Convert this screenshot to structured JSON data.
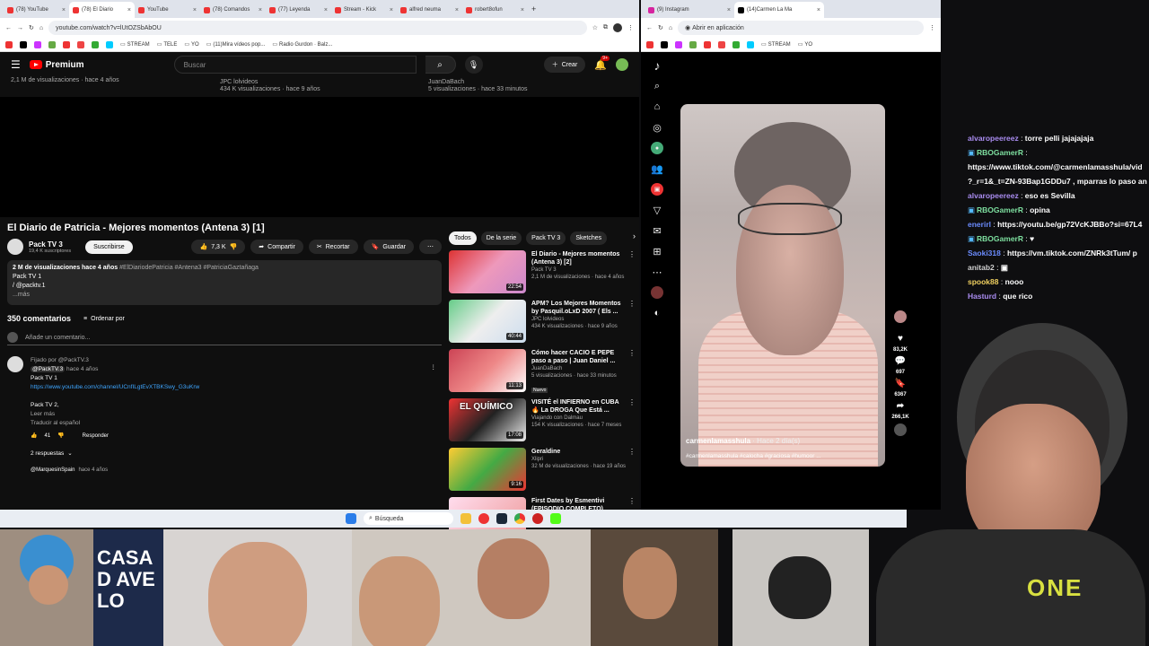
{
  "browser1": {
    "tabs": [
      "(78) YouTube",
      "(78) El Diario",
      "YouTube",
      "(78) Comandos",
      "(77) Leyenda",
      "Stream - Kick",
      "alfred neuma",
      "robert8ofun"
    ],
    "url": "youtube.com/watch?v=lUtOZSbAbOU",
    "bookmarks": [
      "STREAM",
      "TELE",
      "YO",
      "(11)Mira vídeos pop...",
      "Radio Gurdon · Balz..."
    ],
    "yt": {
      "logo": "Premium",
      "search_placeholder": "Buscar",
      "create": "Crear",
      "notif_count": "9+",
      "top_row": [
        {
          "line1": "",
          "line2": "2,1 M de visualizaciones · hace 4 años"
        },
        {
          "line1": "JPC lolvideos",
          "line2": "434 K visualizaciones · hace 9 años"
        },
        {
          "line1": "JuanDaBach",
          "line2": "5 visualizaciones · hace 33 minutos"
        }
      ],
      "video_title": "El Diario de Patricia - Mejores momentos (Antena 3) [1]",
      "channel": "Pack TV 3",
      "subs": "19,4 K suscriptores",
      "subscribe": "Suscribirse",
      "likes": "7,3 K",
      "share": "Compartir",
      "clip": "Recortar",
      "save": "Guardar",
      "desc_stats": "2 M de visualizaciones  hace 4 años",
      "desc_tags": "#ElDiariodePatricia #Antena3 #PatriciaGaztañaga",
      "desc_line2": "Pack TV 1",
      "desc_line3": "/ @packtv.1",
      "desc_more": "...más",
      "comments_count": "350 comentarios",
      "sort": "Ordenar por",
      "add_comment": "Añade un comentario...",
      "comment": {
        "pinned": "Fijado por @PackTV.3",
        "author": "@PackTV.3",
        "time": "hace 4 años",
        "l1": "Pack TV 1",
        "link": "https://www.youtube.com/channel/UCnfILgtEvXTBKSwy_G3uKrw",
        "l3": "Pack TV 2,",
        "more": "Leer más",
        "translate": "Traducir al español",
        "likes": "41",
        "reply": "Responder",
        "replies": "2 respuestas"
      },
      "next_author": "@MarquesinSpain",
      "next_time": "hace 4 años",
      "chips": [
        "Todos",
        "De la serie",
        "Pack TV 3",
        "Sketches"
      ],
      "recs": [
        {
          "title": "El Diario - Mejores momentos (Antena 3) [2]",
          "channel": "Pack TV 3",
          "meta": "2,1 M de visualizaciones · hace 4 años",
          "dur": "22:54",
          "badge": ""
        },
        {
          "title": "APM? Los Mejores Momentos by Pasquil.oLxD 2007 ( Els ...",
          "channel": "JPC lolvideos",
          "meta": "434 K visualizaciones · hace 9 años",
          "dur": "40:44",
          "badge": ""
        },
        {
          "title": "Cómo hacer CACIO E PEPE paso a paso | Juan Daniel ...",
          "channel": "JuanDaBach",
          "meta": "5 visualizaciones · hace 33 minutos",
          "dur": "11:13",
          "badge": "Nuevo"
        },
        {
          "title": "VISITÉ el INFIERNO en CUBA 🔥 La DROGA Que Está ...",
          "channel": "Viajando con Dalmau",
          "meta": "154 K visualizaciones · hace 7 meses",
          "dur": "17:08",
          "badge": ""
        },
        {
          "title": "Geraldine",
          "channel": "Xlipri",
          "meta": "32 M de visualizaciones · hace 19 años",
          "dur": "9:16",
          "badge": ""
        },
        {
          "title": "First Dates by Esmentivi (EPISODIO COMPLETO)",
          "channel": "",
          "meta": "",
          "dur": "",
          "badge": ""
        }
      ],
      "thumb_text": "EL QUÍMICO"
    }
  },
  "browser2": {
    "tabs": [
      "(9) Instagram",
      "(14)Carmen La Ma"
    ],
    "open_app": "Abrir en aplicación",
    "bookmarks": [
      "STREAM",
      "YO"
    ],
    "tiktok": {
      "user": "carmenlamasshula",
      "when": "· Hace 2 día(s)",
      "caption": "#carmenlamasshula #calocha #graciosa #humoor ...",
      "likes": "83,2K",
      "comments": "697",
      "saves": "6367",
      "shares": "266,1K"
    }
  },
  "chat": [
    {
      "user": "alvaropeereez",
      "color": "#a98cf0",
      "msg": "torre pelli jajajajaja",
      "badge": ""
    },
    {
      "user": "RBOGamerR",
      "color": "#7ee0a0",
      "msg": "",
      "badge": "▣"
    },
    {
      "user": "",
      "color": "",
      "msg": "https://www.tiktok.com/@carmenlamasshula/vid",
      "badge": ""
    },
    {
      "user": "",
      "color": "",
      "msg": "?_r=1&_t=ZN-93Bap1GDDu7 , mparras lo paso an",
      "badge": ""
    },
    {
      "user": "alvaropeereez",
      "color": "#a98cf0",
      "msg": "eso es Sevilla",
      "badge": ""
    },
    {
      "user": "RBOGamerR",
      "color": "#7ee0a0",
      "msg": "opina",
      "badge": "▣"
    },
    {
      "user": "enerirl",
      "color": "#6b8cff",
      "msg": "https://youtu.be/gp72VcKJBBo?si=67L4",
      "badge": ""
    },
    {
      "user": "RBOGamerR",
      "color": "#7ee0a0",
      "msg": "♥",
      "badge": "▣"
    },
    {
      "user": "Saoki318",
      "color": "#6b8cff",
      "msg": "https://vm.tiktok.com/ZNRk3tTum/ p",
      "badge": ""
    },
    {
      "user": "anitab2",
      "color": "#d0d0d0",
      "msg": "▣",
      "badge": ""
    },
    {
      "user": "spook88",
      "color": "#f0d060",
      "msg": "nooo",
      "badge": ""
    },
    {
      "user": "Hasturd",
      "color": "#a98cf0",
      "msg": "que rico",
      "badge": ""
    }
  ],
  "taskbar": {
    "search": "Búsqueda"
  },
  "cams": {
    "cam2_text": "CASA D AVELO",
    "shirt_text": "ONE"
  }
}
